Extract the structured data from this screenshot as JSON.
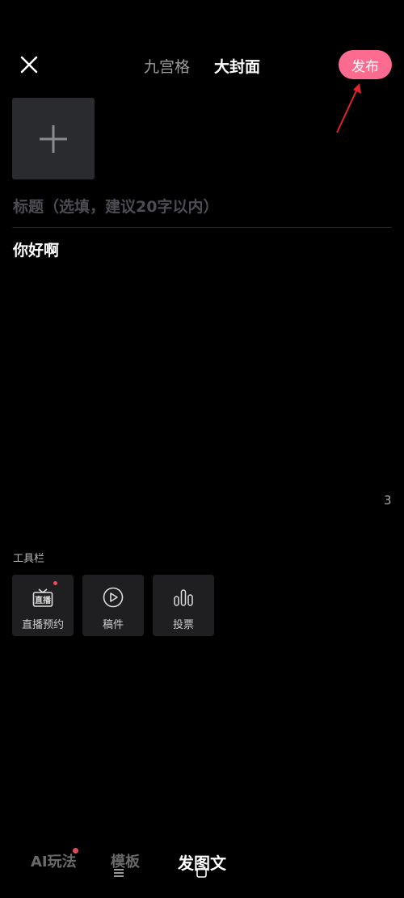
{
  "header": {
    "tabs": [
      "九宫格",
      "大封面"
    ],
    "active_tab": "大封面",
    "publish_label": "发布"
  },
  "editor": {
    "title_placeholder": "标题（选填，建议20字以内）",
    "body_text": "你好啊",
    "char_count": "3"
  },
  "toolbar": {
    "label": "工具栏",
    "items": [
      {
        "label": "直播预约",
        "icon": "live-icon",
        "badge": true
      },
      {
        "label": "稿件",
        "icon": "play-circle-icon",
        "badge": false
      },
      {
        "label": "投票",
        "icon": "vote-bars-icon",
        "badge": false
      }
    ],
    "live_icon_text": "直播"
  },
  "bottom_nav": {
    "items": [
      "AI玩法",
      "模板",
      "发图文"
    ],
    "active": "发图文"
  },
  "colors": {
    "accent": "#fe6b90",
    "annotation_arrow": "#e0242b",
    "background": "#000000"
  }
}
